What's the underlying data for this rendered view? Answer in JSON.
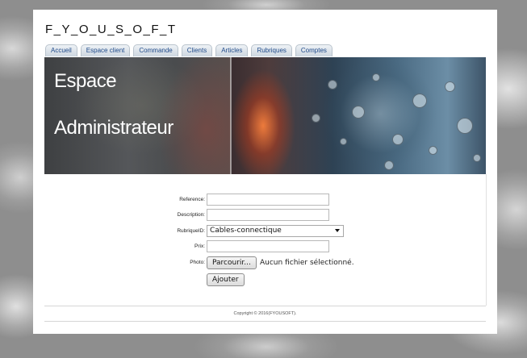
{
  "logo": "F_Y_O_U_S_O_F_T",
  "tabs": [
    {
      "label": "Accueil"
    },
    {
      "label": "Espace client"
    },
    {
      "label": "Commande"
    },
    {
      "label": "Clients"
    },
    {
      "label": "Articles"
    },
    {
      "label": "Rubriques"
    },
    {
      "label": "Comptes"
    }
  ],
  "banner": {
    "line1": "Espace",
    "line2": "Administrateur"
  },
  "form": {
    "reference_label": "Reference:",
    "reference_value": "",
    "description_label": "Description:",
    "description_value": "",
    "rubrique_label": "RubriqueID:",
    "rubrique_selected": "Cables-connectique",
    "prix_label": "Prix:",
    "prix_value": "",
    "photo_label": "Photo:",
    "browse_button": "Parcourir...",
    "file_status": "Aucun fichier sélectionné.",
    "submit_button": "Ajouter"
  },
  "footer": {
    "copyright": "Copyright © 2016(FYOUSOFT)."
  },
  "colors": {
    "tab_text": "#1f4a8a",
    "page_bg": "#ffffff"
  }
}
